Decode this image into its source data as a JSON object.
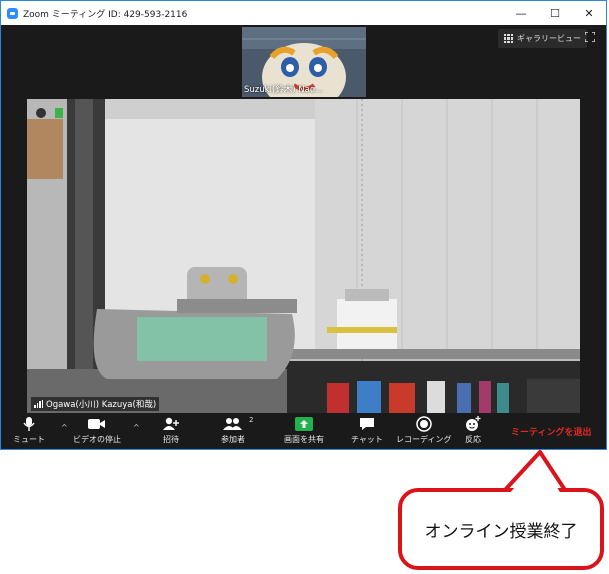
{
  "window": {
    "title": "Zoom ミーティング ID: 429-593-2116",
    "controls": {
      "minimize": "—",
      "maximize": "☐",
      "close": "✕"
    }
  },
  "thumbnail": {
    "name": "Suzuki(鈴木) Nao..."
  },
  "view": {
    "gallery_label": "ギャラリービュー"
  },
  "main_video": {
    "participant": "Ogawa(小川) Kazuya(和哉)"
  },
  "toolbar": {
    "mute": "ミュート",
    "stop_video": "ビデオの停止",
    "invite": "招待",
    "participants": "参加者",
    "participants_count": "2",
    "share": "画面を共有",
    "chat": "チャット",
    "record": "レコーディング",
    "reactions": "反応",
    "leave": "ミーティングを退出"
  },
  "callout": {
    "text": "オンライン授業終了"
  },
  "colors": {
    "accent": "#2d8cff",
    "share_green": "#22b14c",
    "leave_red": "#e02828",
    "callout_border": "#d9141b"
  }
}
